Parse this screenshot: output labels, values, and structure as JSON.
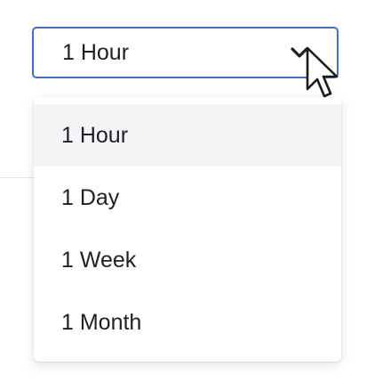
{
  "select": {
    "value": "1 Hour",
    "icon": "chevron-down-icon",
    "accent_color": "#3d6fd6"
  },
  "dropdown": {
    "options": [
      {
        "label": "1 Hour",
        "selected": true
      },
      {
        "label": "1 Day",
        "selected": false
      },
      {
        "label": "1 Week",
        "selected": false
      },
      {
        "label": "1 Month",
        "selected": false
      }
    ],
    "selected_bg": "#f4f4f7"
  },
  "cursor": {
    "icon": "mouse-pointer-icon"
  }
}
